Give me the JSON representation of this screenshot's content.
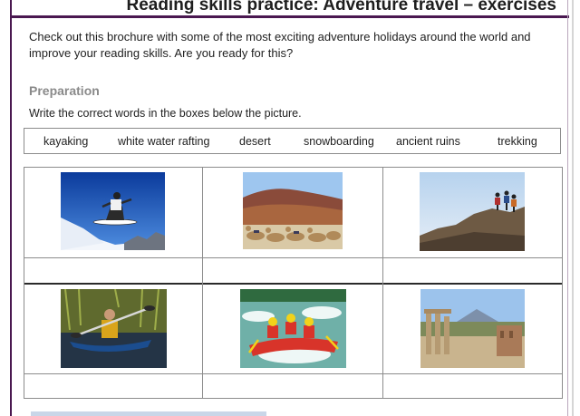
{
  "header": {
    "title": "Reading skills practice: Adventure travel – exercises"
  },
  "intro": {
    "text": "Check out this brochure with some of the most exciting adventure holidays around the world and improve your reading skills. Are you ready for this?"
  },
  "preparation": {
    "heading": "Preparation",
    "instruction": "Write the correct words in the boxes below the picture.",
    "words": [
      "kayaking",
      "white water rafting",
      "desert",
      "snowboarding",
      "ancient ruins",
      "trekking"
    ]
  },
  "pictures": [
    {
      "icon": "snowboarding-photo"
    },
    {
      "icon": "desert-camels-photo"
    },
    {
      "icon": "trekking-photo"
    },
    {
      "icon": "kayaking-photo"
    },
    {
      "icon": "white-water-rafting-photo"
    },
    {
      "icon": "ancient-ruins-photo"
    }
  ],
  "colors": {
    "frame": "#4a1850",
    "heading_gray": "#8a8a8a",
    "border": "#8c8c8c"
  }
}
